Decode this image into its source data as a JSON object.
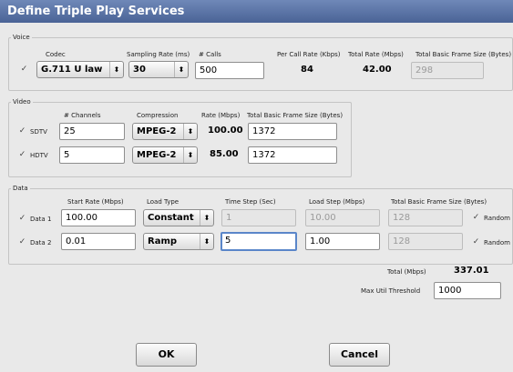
{
  "window": {
    "title": "Define Triple Play Services"
  },
  "voice": {
    "legend": "Voice",
    "headers": {
      "codec": "Codec",
      "sampling_rate": "Sampling Rate (ms)",
      "calls": "# Calls",
      "per_call_rate": "Per Call Rate (Kbps)",
      "total_rate": "Total Rate (Mbps)",
      "total_frame_size": "Total Basic Frame Size (Bytes)"
    },
    "checkbox_glyph": "✓",
    "codec": "G.711 U law",
    "sampling_rate": "30",
    "calls": "500",
    "per_call_rate": "84",
    "total_rate": "42.00",
    "total_frame_size": "298"
  },
  "video": {
    "legend": "Video",
    "headers": {
      "channels": "# Channels",
      "compression": "Compression",
      "rate": "Rate (Mbps)",
      "total_frame_size": "Total Basic Frame Size (Bytes)"
    },
    "rows": [
      {
        "check": "✓",
        "label": "SDTV",
        "channels": "25",
        "compression": "MPEG-2",
        "rate": "100.00",
        "frame_size": "1372"
      },
      {
        "check": "✓",
        "label": "HDTV",
        "channels": "5",
        "compression": "MPEG-2",
        "rate": "85.00",
        "frame_size": "1372"
      }
    ]
  },
  "data": {
    "legend": "Data",
    "headers": {
      "start_rate": "Start Rate (Mbps)",
      "load_type": "Load Type",
      "time_step": "Time Step (Sec)",
      "load_step": "Load Step (Mbps)",
      "total_frame_size": "Total Basic Frame Size (Bytes)"
    },
    "rows": [
      {
        "check": "✓",
        "label": "Data 1",
        "start_rate": "100.00",
        "load_type": "Constant",
        "time_step": "1",
        "load_step": "10.00",
        "frame_size": "128",
        "random_check": "✓",
        "random_label": "Random"
      },
      {
        "check": "✓",
        "label": "Data 2",
        "start_rate": "0.01",
        "load_type": "Ramp",
        "time_step": "5",
        "load_step": "1.00",
        "frame_size": "128",
        "random_check": "✓",
        "random_label": "Random"
      }
    ]
  },
  "summary": {
    "total_label": "Total (Mbps)",
    "total_value": "337.01",
    "threshold_label": "Max Util Threshold",
    "threshold_value": "1000"
  },
  "icons": {
    "select_arrow": "⬍"
  },
  "buttons": {
    "ok": "OK",
    "cancel": "Cancel"
  }
}
